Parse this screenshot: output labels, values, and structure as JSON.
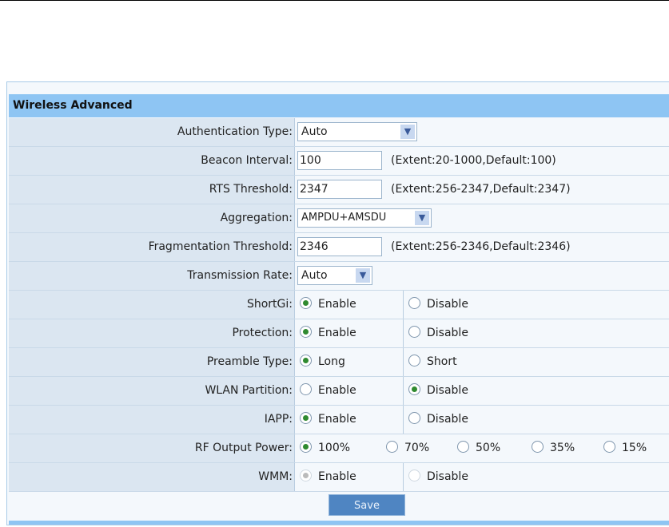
{
  "title": "Wireless Advanced",
  "fields": {
    "auth": {
      "label": "Authentication Type:",
      "value": "Auto"
    },
    "beacon": {
      "label": "Beacon Interval:",
      "value": "100",
      "hint": "(Extent:20-1000,Default:100)"
    },
    "rts": {
      "label": "RTS Threshold:",
      "value": "2347",
      "hint": "(Extent:256-2347,Default:2347)"
    },
    "agg": {
      "label": "Aggregation:",
      "value": "AMPDU+AMSDU"
    },
    "frag": {
      "label": "Fragmentation Threshold:",
      "value": "2346",
      "hint": "(Extent:256-2346,Default:2346)"
    },
    "rate": {
      "label": "Transmission Rate:",
      "value": "Auto"
    }
  },
  "radios": {
    "shortgi": {
      "label": "ShortGi:",
      "opts": [
        "Enable",
        "Disable"
      ],
      "selected": 0
    },
    "protection": {
      "label": "Protection:",
      "opts": [
        "Enable",
        "Disable"
      ],
      "selected": 0
    },
    "preamble": {
      "label": "Preamble Type:",
      "opts": [
        "Long",
        "Short"
      ],
      "selected": 0
    },
    "wlan": {
      "label": "WLAN Partition:",
      "opts": [
        "Enable",
        "Disable"
      ],
      "selected": 1
    },
    "iapp": {
      "label": "IAPP:",
      "opts": [
        "Enable",
        "Disable"
      ],
      "selected": 0
    },
    "rf": {
      "label": "RF Output Power:",
      "opts": [
        "100%",
        "70%",
        "50%",
        "35%",
        "15%"
      ],
      "selected": 0
    },
    "wmm": {
      "label": "WMM:",
      "opts": [
        "Enable",
        "Disable"
      ],
      "selected": 0,
      "disabled": true
    }
  },
  "save_label": "Save"
}
